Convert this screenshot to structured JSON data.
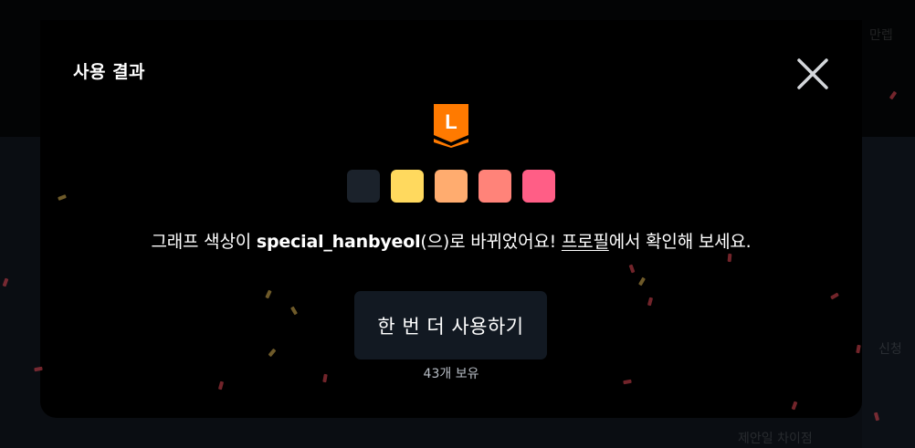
{
  "modal": {
    "title": "사용 결과",
    "message": {
      "before": "그래프 색상이 ",
      "theme_name": "special_hanbyeol",
      "middle": "(으)로 바뀌었어요! ",
      "link": "프로필",
      "after": "에서 확인해 보세요."
    },
    "reuse_label": "한 번 더 사용하기",
    "owned_label": "43개 보유",
    "badge": {
      "letter": "L",
      "color": "#ff7a00",
      "icon": "rank-badge-icon"
    },
    "swatch_colors": [
      "#1b222b",
      "#ffd95e",
      "#ffac6f",
      "#ff8379",
      "#ff5e86"
    ]
  },
  "background": {
    "faint_texts": [
      "만렙",
      "신청",
      "제안일 차이점"
    ]
  }
}
